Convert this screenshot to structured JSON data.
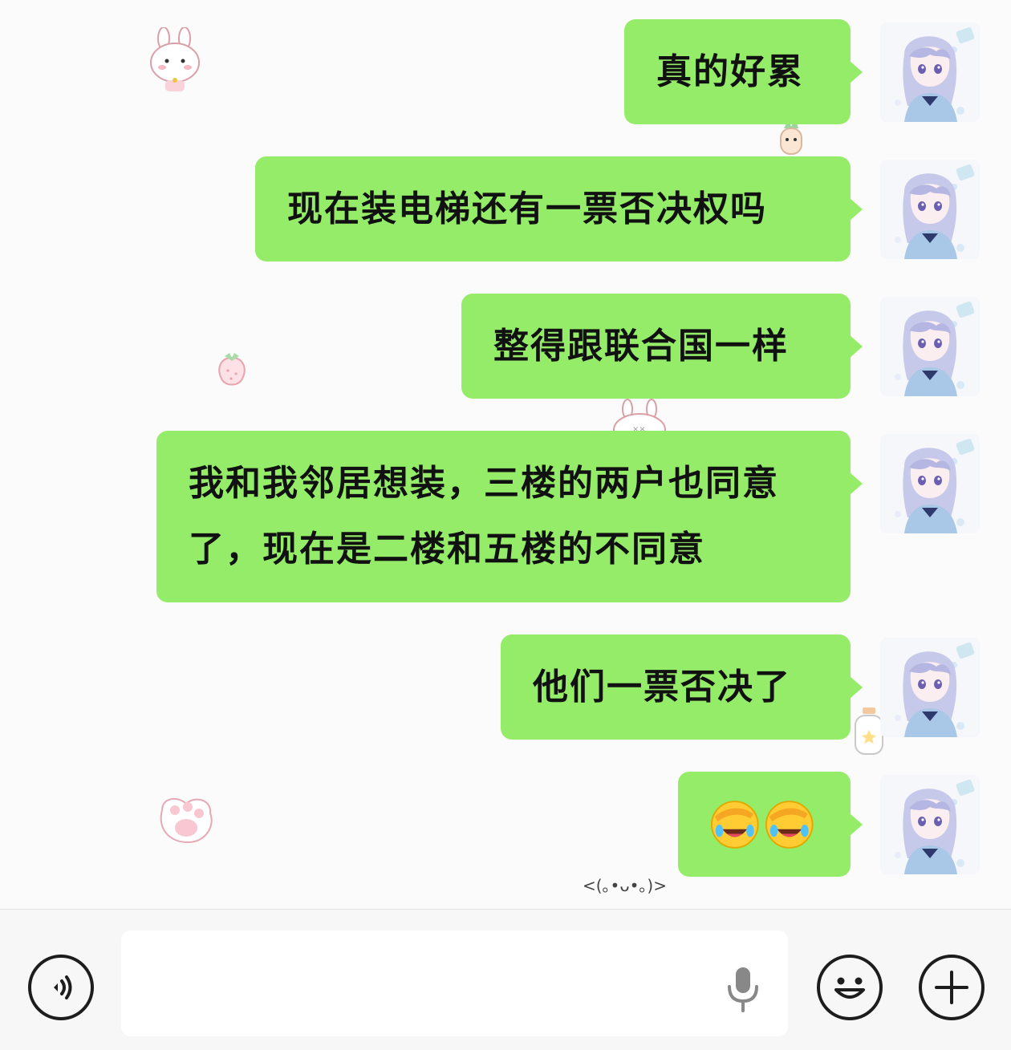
{
  "chat": {
    "messages": [
      {
        "sender": "self",
        "text": "真的好累"
      },
      {
        "sender": "self",
        "text": "现在装电梯还有一票否决权吗"
      },
      {
        "sender": "self",
        "text": "整得跟联合国一样"
      },
      {
        "sender": "self",
        "line1": "我和我邻居想装，三楼的两户也同意",
        "line2": "了，现在是二楼和五楼的不同意"
      },
      {
        "sender": "self",
        "text": "他们一票否决了"
      },
      {
        "sender": "self",
        "emojis": [
          "face-palm-laughing-emoji",
          "face-palm-laughing-emoji"
        ]
      }
    ],
    "wallpaper_kaomoji": "<(｡•ᴗ•｡)>",
    "bubble_color": "#95ec69"
  },
  "input_bar": {
    "voice_toggle_icon": "voice-wave-icon",
    "text_field_value": "",
    "mic_icon": "microphone-icon",
    "emoji_icon": "smiley-face-icon",
    "more_icon": "plus-icon"
  }
}
